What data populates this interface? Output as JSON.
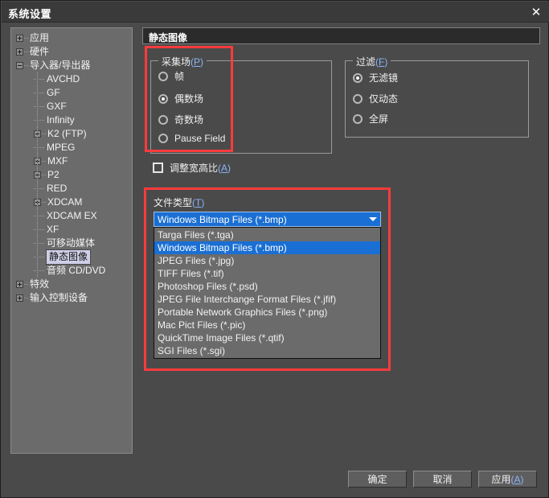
{
  "window": {
    "title": "系统设置",
    "close_icon": "close-icon"
  },
  "tree": {
    "items": [
      {
        "label": "应用",
        "depth": 0,
        "toggle": "plus"
      },
      {
        "label": "硬件",
        "depth": 0,
        "toggle": "plus"
      },
      {
        "label": "导入器/导出器",
        "depth": 0,
        "toggle": "minus"
      },
      {
        "label": "AVCHD",
        "depth": 1,
        "toggle": "none"
      },
      {
        "label": "GF",
        "depth": 1,
        "toggle": "none"
      },
      {
        "label": "GXF",
        "depth": 1,
        "toggle": "none"
      },
      {
        "label": "Infinity",
        "depth": 1,
        "toggle": "none"
      },
      {
        "label": "K2 (FTP)",
        "depth": 1,
        "toggle": "plus"
      },
      {
        "label": "MPEG",
        "depth": 1,
        "toggle": "none"
      },
      {
        "label": "MXF",
        "depth": 1,
        "toggle": "plus"
      },
      {
        "label": "P2",
        "depth": 1,
        "toggle": "plus"
      },
      {
        "label": "RED",
        "depth": 1,
        "toggle": "none"
      },
      {
        "label": "XDCAM",
        "depth": 1,
        "toggle": "plus"
      },
      {
        "label": "XDCAM EX",
        "depth": 1,
        "toggle": "none"
      },
      {
        "label": "XF",
        "depth": 1,
        "toggle": "none"
      },
      {
        "label": "可移动媒体",
        "depth": 1,
        "toggle": "none"
      },
      {
        "label": "静态图像",
        "depth": 1,
        "toggle": "none",
        "selected": true
      },
      {
        "label": "音频 CD/DVD",
        "depth": 1,
        "toggle": "none"
      },
      {
        "label": "特效",
        "depth": 0,
        "toggle": "plus"
      },
      {
        "label": "输入控制设备",
        "depth": 0,
        "toggle": "plus"
      }
    ]
  },
  "panel": {
    "header_title": "静态图像",
    "capture_group": {
      "title": "采集场(P)",
      "title_text": "采集场",
      "accel": "P",
      "options": [
        {
          "label": "帧",
          "selected": false
        },
        {
          "label": "偶数场",
          "selected": true
        },
        {
          "label": "奇数场",
          "selected": false
        },
        {
          "label": "Pause Field",
          "selected": false
        }
      ]
    },
    "filter_group": {
      "title": "过滤(F)",
      "title_text": "过滤",
      "accel": "F",
      "options": [
        {
          "label": "无滤镜",
          "selected": true
        },
        {
          "label": "仅动态",
          "selected": false
        },
        {
          "label": "全屏",
          "selected": false
        }
      ]
    },
    "aspect_checkbox": {
      "label": "调整宽高比(A)",
      "label_text": "调整宽高比",
      "accel": "A",
      "checked": false
    },
    "filetype": {
      "label": "文件类型(T)",
      "label_text": "文件类型",
      "accel": "T",
      "selected_value": "Windows Bitmap Files (*.bmp)",
      "dropdown_icon": "chevron-down-icon",
      "options": [
        "Targa Files (*.tga)",
        "Windows Bitmap Files (*.bmp)",
        "JPEG Files (*.jpg)",
        "TIFF Files (*.tif)",
        "Photoshop Files (*.psd)",
        "JPEG File Interchange Format Files (*.jfif)",
        "Portable Network Graphics Files (*.png)",
        "Mac Pict Files (*.pic)",
        "QuickTime Image Files (*.qtif)",
        "SGI Files (*.sgi)"
      ]
    }
  },
  "buttons": {
    "ok": "确定",
    "cancel": "取消",
    "apply": "应用(A)",
    "apply_text": "应用",
    "apply_accel": "A"
  },
  "annotations": {
    "highlight_color": "#fb3b3b",
    "boxes": [
      "capture-field-group",
      "file-type-group"
    ]
  }
}
